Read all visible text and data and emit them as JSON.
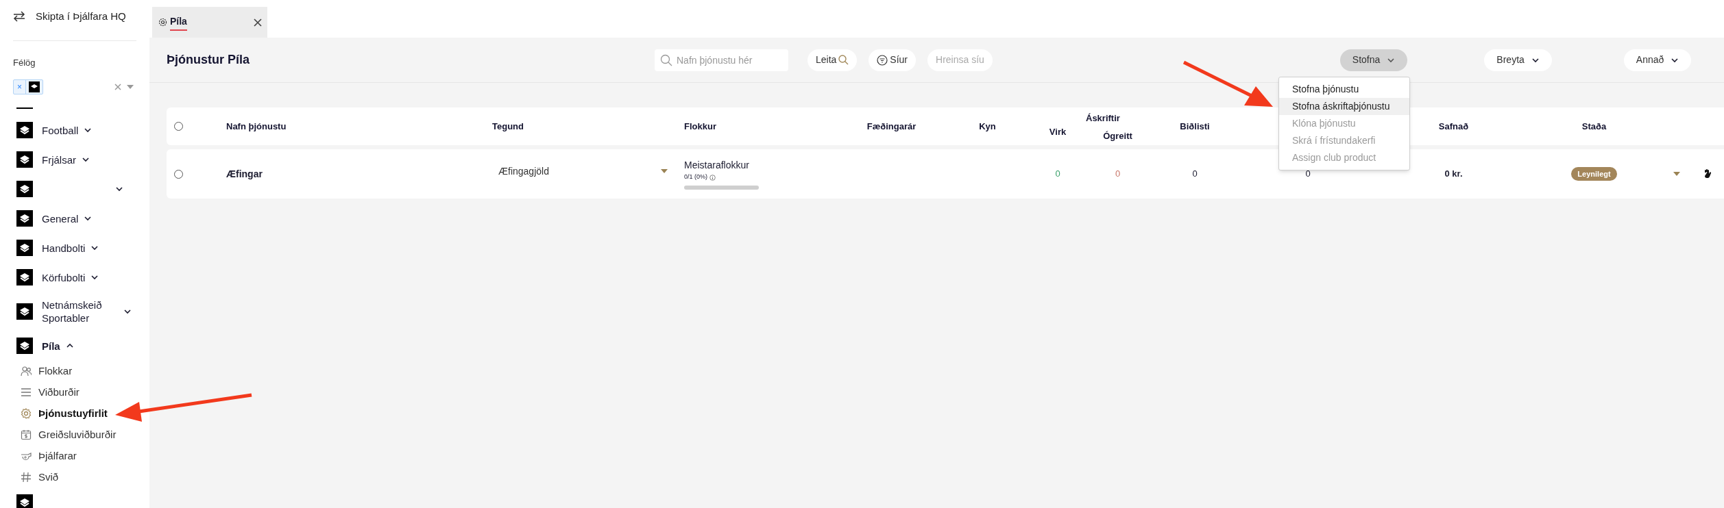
{
  "sidebar": {
    "switch_label": "Skipta í Þjálfara HQ",
    "section_label": "Félög",
    "club_select": {
      "chip_remove": "×"
    },
    "groups": [
      {
        "label": "Football",
        "expanded": false
      },
      {
        "label": "Frjálsar",
        "expanded": false
      },
      {
        "expanded": false
      },
      {
        "label": "General",
        "expanded": false
      },
      {
        "label": "Handbolti",
        "expanded": false
      },
      {
        "label": "Körfubolti",
        "expanded": false
      },
      {
        "label": "Netnámskeið Sportabler",
        "expanded": false
      },
      {
        "label": "Píla",
        "expanded": true,
        "children": [
          {
            "label": "Flokkar",
            "selected": false
          },
          {
            "label": "Viðburðir",
            "selected": false
          },
          {
            "label": "Þjónustuyfirlit",
            "selected": true
          },
          {
            "label": "Greiðsluviðburðir",
            "selected": false
          },
          {
            "label": "Þjálfarar",
            "selected": false
          },
          {
            "label": "Svið",
            "selected": false
          }
        ]
      }
    ]
  },
  "tabs": [
    {
      "label": "Píla",
      "selected": true
    }
  ],
  "header": {
    "title": "Þjónustur Píla",
    "search": {
      "placeholder": "Nafn þjónustu hér"
    },
    "buttons": [
      {
        "kind": "search",
        "label": "Leita",
        "disabled": false
      },
      {
        "kind": "filter",
        "label": "Síur",
        "disabled": false
      },
      {
        "kind": "plain",
        "label": "Hreinsa síu",
        "disabled": true
      }
    ],
    "menus": [
      {
        "label": "Stofna",
        "open": true
      },
      {
        "label": "Breyta",
        "open": false
      },
      {
        "label": "Annað",
        "open": false
      }
    ],
    "create_menu": [
      {
        "label": "Stofna þjónustu",
        "disabled": false,
        "selected": false
      },
      {
        "label": "Stofna áskriftaþjónustu",
        "disabled": false,
        "selected": true
      },
      {
        "label": "Klóna þjónustu",
        "disabled": true,
        "selected": false
      },
      {
        "label": "Skrá í frístundakerfi",
        "disabled": true,
        "selected": false
      },
      {
        "label": "Assign club product",
        "disabled": true,
        "selected": false
      }
    ]
  },
  "table": {
    "select_all": {
      "selected": false
    },
    "columns": {
      "name": "Nafn þjónustu",
      "type": "Tegund",
      "category": "Flokkur",
      "birth_year": "Fæðingarár",
      "gender": "Kyn",
      "subscriptions": "Áskriftir",
      "active": "Virk",
      "unpaid": "Ógreitt",
      "waitlist": "Biðlisti",
      "collected": "Safnað",
      "status": "Staða"
    },
    "rows": [
      {
        "selected": false,
        "name": "Æfingar",
        "type": "Æfingagjöld",
        "category": {
          "name": "Meistaraflokkur",
          "count": "0/1 (0%)",
          "level": 0
        },
        "active": "0",
        "unpaid": "0",
        "waitlist": "0",
        "column_10": "0",
        "collected": "0 kr.",
        "status": "Leynilegt"
      }
    ]
  }
}
